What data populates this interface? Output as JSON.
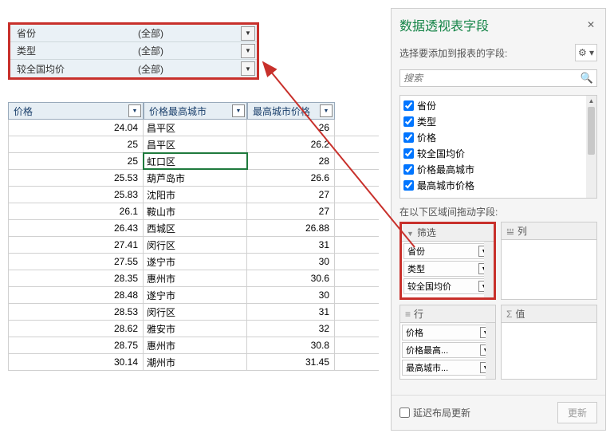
{
  "filters": [
    {
      "label": "省份",
      "value": "(全部)"
    },
    {
      "label": "类型",
      "value": "(全部)"
    },
    {
      "label": "较全国均价",
      "value": "(全部)"
    }
  ],
  "columns": [
    "价格",
    "价格最高城市",
    "最高城市价格"
  ],
  "rows": [
    {
      "price": "24.04",
      "city": "昌平区",
      "max": "26"
    },
    {
      "price": "25",
      "city": "昌平区",
      "max": "26.2"
    },
    {
      "price": "25",
      "city": "虹口区",
      "max": "28",
      "selected": true
    },
    {
      "price": "25.53",
      "city": "葫芦岛市",
      "max": "26.6"
    },
    {
      "price": "25.83",
      "city": "沈阳市",
      "max": "27"
    },
    {
      "price": "26.1",
      "city": "鞍山市",
      "max": "27"
    },
    {
      "price": "26.43",
      "city": "西城区",
      "max": "26.88"
    },
    {
      "price": "27.41",
      "city": "闵行区",
      "max": "31"
    },
    {
      "price": "27.55",
      "city": "遂宁市",
      "max": "30"
    },
    {
      "price": "28.35",
      "city": "惠州市",
      "max": "30.6"
    },
    {
      "price": "28.48",
      "city": "遂宁市",
      "max": "30"
    },
    {
      "price": "28.53",
      "city": "闵行区",
      "max": "31"
    },
    {
      "price": "28.62",
      "city": "雅安市",
      "max": "32"
    },
    {
      "price": "28.75",
      "city": "惠州市",
      "max": "30.8"
    },
    {
      "price": "30.14",
      "city": "潮州市",
      "max": "31.45"
    }
  ],
  "pane": {
    "title": "数据透视表字段",
    "sub": "选择要添加到报表的字段:",
    "search_placeholder": "搜索",
    "fields": [
      "省份",
      "类型",
      "价格",
      "较全国均价",
      "价格最高城市",
      "最高城市价格"
    ],
    "areas_label": "在以下区域间拖动字段:",
    "area_filter": "筛选",
    "area_cols": "列",
    "area_rows": "行",
    "area_values": "值",
    "filter_chips": [
      "省份",
      "类型",
      "较全国均价"
    ],
    "row_chips": [
      "价格",
      "价格最高...",
      "最高城市..."
    ],
    "defer": "延迟布局更新",
    "update": "更新"
  }
}
